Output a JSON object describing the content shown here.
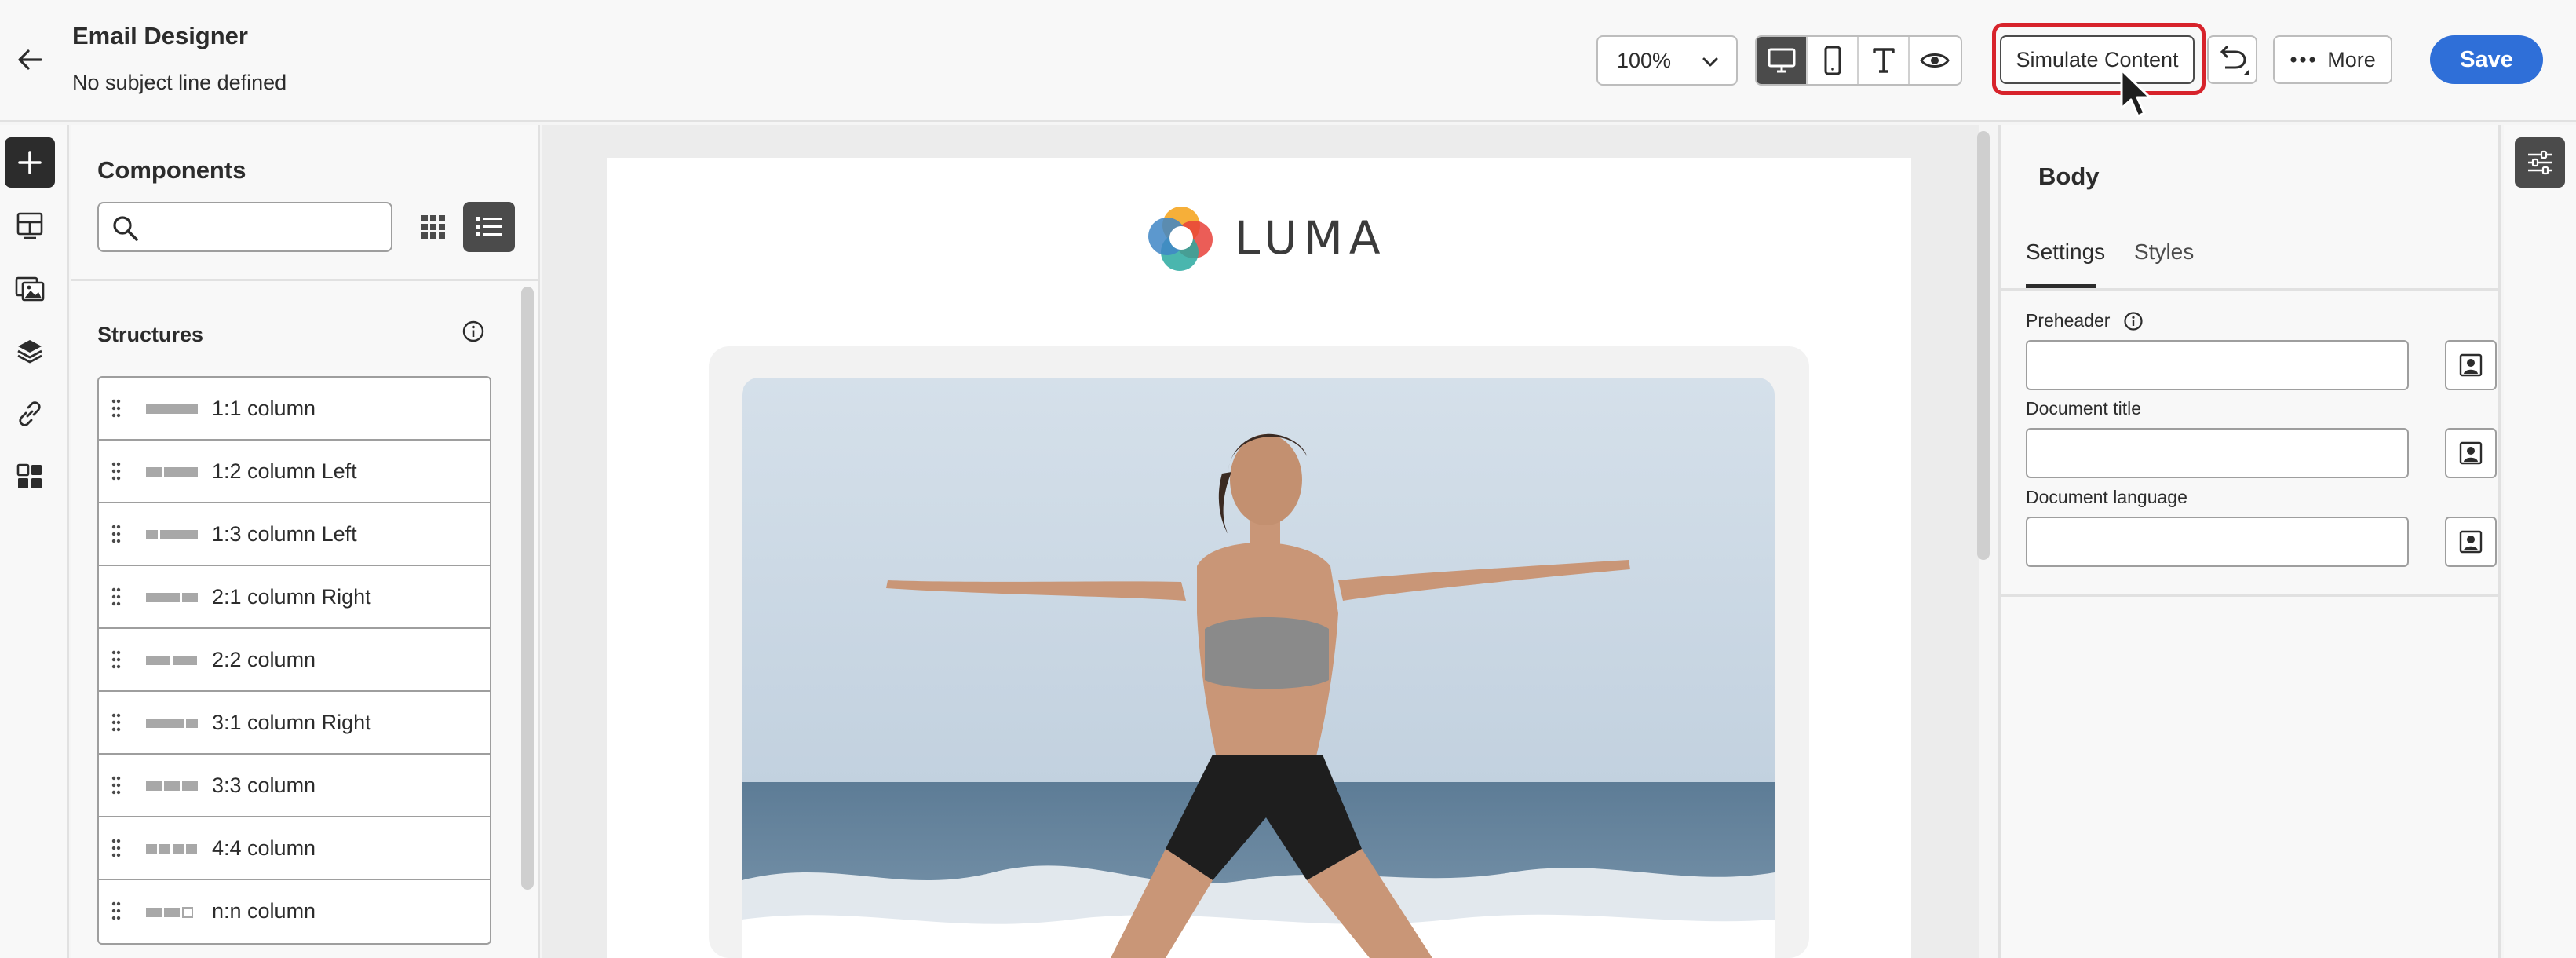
{
  "header": {
    "title": "Email Designer",
    "subject": "No subject line defined",
    "zoom": "100%",
    "simulate_label": "Simulate Content",
    "more_label": "More",
    "save_label": "Save"
  },
  "components": {
    "title": "Components",
    "search_placeholder": "",
    "structures_label": "Structures",
    "structures": [
      {
        "label": "1:1 column"
      },
      {
        "label": "1:2 column Left"
      },
      {
        "label": "1:3 column Left"
      },
      {
        "label": "2:1 column Right"
      },
      {
        "label": "2:2 column"
      },
      {
        "label": "3:1 column Right"
      },
      {
        "label": "3:3 column"
      },
      {
        "label": "4:4 column"
      },
      {
        "label": "n:n column"
      }
    ]
  },
  "canvas": {
    "logo_text": "LUMA"
  },
  "properties": {
    "title": "Body",
    "tabs": [
      "Settings",
      "Styles"
    ],
    "active_tab": "Settings",
    "fields": [
      {
        "label": "Preheader",
        "value": ""
      },
      {
        "label": "Document title",
        "value": ""
      },
      {
        "label": "Document language",
        "value": ""
      }
    ]
  },
  "colors": {
    "accent": "#2f6fd8",
    "highlight": "#d7232b",
    "dark": "#4b4b4b"
  }
}
